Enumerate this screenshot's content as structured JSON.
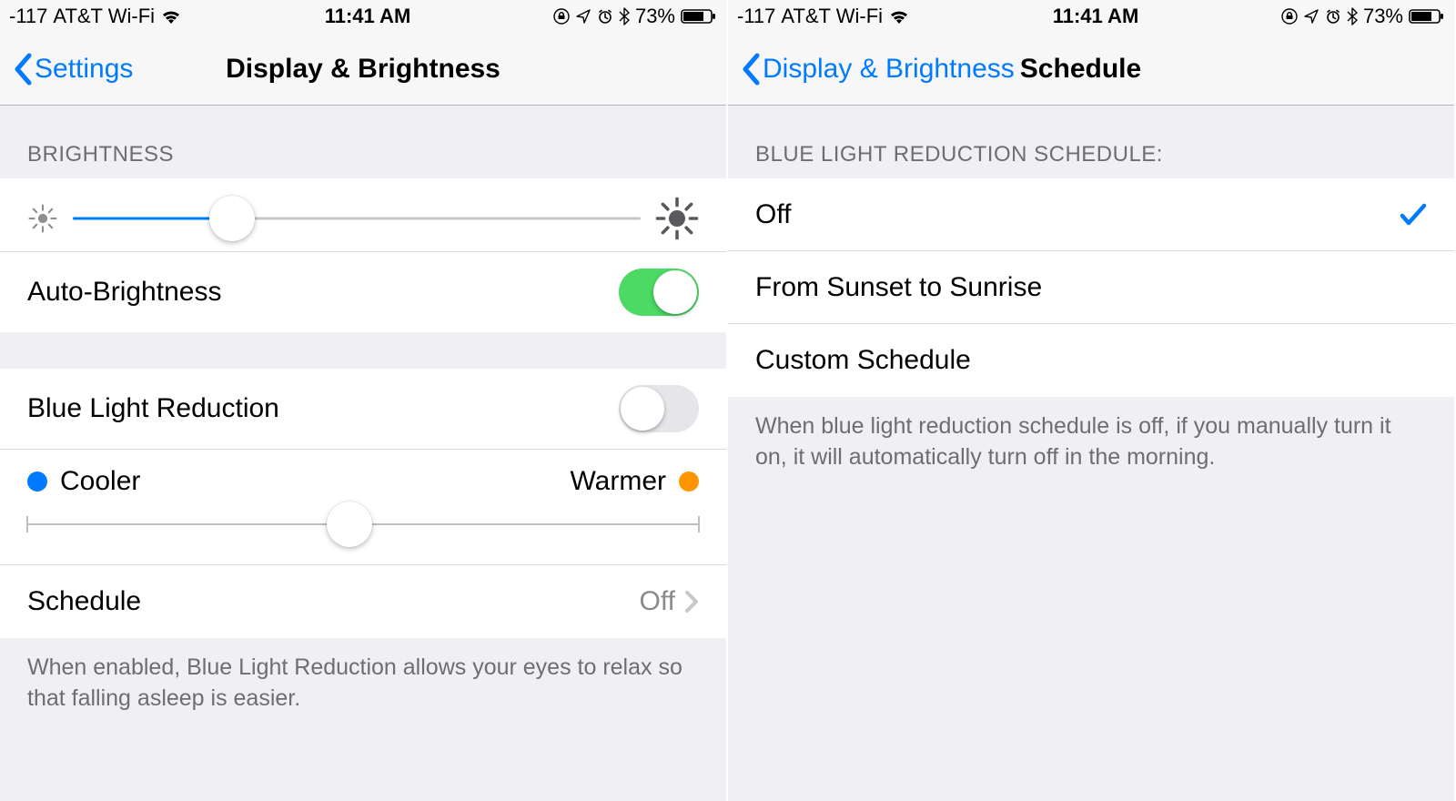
{
  "status": {
    "signal": "-117",
    "carrier": "AT&T Wi-Fi",
    "time": "11:41 AM",
    "battery_pct": "73%"
  },
  "left": {
    "back_label": "Settings",
    "title": "Display & Brightness",
    "section_brightness": "BRIGHTNESS",
    "brightness_value_pct": 28,
    "auto_brightness_label": "Auto-Brightness",
    "auto_brightness_on": true,
    "blue_light_label": "Blue Light Reduction",
    "blue_light_on": false,
    "temp_cooler_label": "Cooler",
    "temp_warmer_label": "Warmer",
    "temp_value_pct": 48,
    "schedule_label": "Schedule",
    "schedule_value": "Off",
    "footer": "When enabled, Blue Light Reduction allows your eyes to relax so that falling asleep is easier."
  },
  "right": {
    "back_label": "Display & Brightness",
    "title": "Schedule",
    "section_header": "BLUE LIGHT REDUCTION SCHEDULE:",
    "options": [
      {
        "label": "Off",
        "selected": true
      },
      {
        "label": "From Sunset to Sunrise",
        "selected": false
      },
      {
        "label": "Custom Schedule",
        "selected": false
      }
    ],
    "footer": "When blue light reduction schedule is off, if you manually turn it on, it will automatically turn off in the morning."
  }
}
